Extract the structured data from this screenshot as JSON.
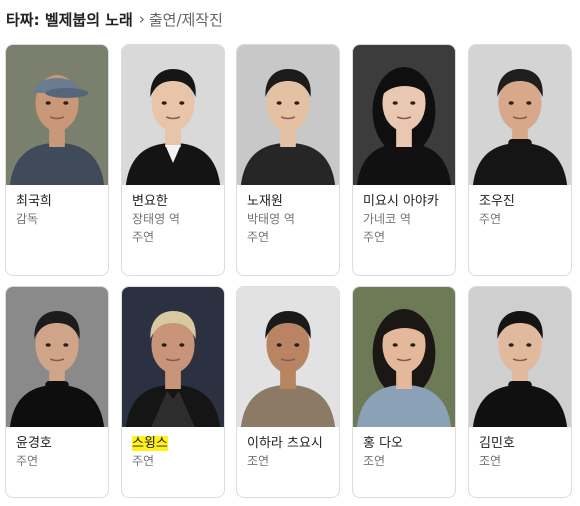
{
  "header": {
    "title": "타짜: 벨제붑의 노래",
    "chevron": "›",
    "subtitle": "출연/제작진"
  },
  "rows": [
    [
      {
        "name": "최국희",
        "roles": [
          "감독"
        ],
        "photo": {
          "bg": "#7a7f6e",
          "skin": "#c99878",
          "hair": "#2a2a2a",
          "shirt": "#3f4a5a",
          "accessory": "cap"
        }
      },
      {
        "name": "변요한",
        "roles": [
          "장태영 역",
          "주연"
        ],
        "photo": {
          "bg": "#d9d9d9",
          "skin": "#e8c4a8",
          "hair": "#161616",
          "shirt": "#141414",
          "accessory": "shirt-collar"
        }
      },
      {
        "name": "노재원",
        "roles": [
          "박태영 역",
          "주연"
        ],
        "photo": {
          "bg": "#c8c8c8",
          "skin": "#e3c1a2",
          "hair": "#1b1b1b",
          "shirt": "#262626",
          "accessory": "none"
        }
      },
      {
        "name": "미요시 아야카",
        "roles": [
          "가네코 역",
          "주연"
        ],
        "photo": {
          "bg": "#3c3c3c",
          "skin": "#e9c7b0",
          "hair": "#0f0f0f",
          "shirt": "#111111",
          "accessory": "long-hair"
        }
      },
      {
        "name": "조우진",
        "roles": [
          "주연"
        ],
        "photo": {
          "bg": "#d4d4d4",
          "skin": "#d7a98a",
          "hair": "#1e1e1e",
          "shirt": "#151515",
          "accessory": "turtleneck"
        }
      }
    ],
    [
      {
        "name": "윤경호",
        "roles": [
          "주연"
        ],
        "photo": {
          "bg": "#8a8a8a",
          "skin": "#cfa488",
          "hair": "#1c1c1c",
          "shirt": "#0e0e0e",
          "accessory": "turtleneck"
        }
      },
      {
        "name": "스윙스",
        "roles": [
          "주연"
        ],
        "highlight": true,
        "photo": {
          "bg": "#2b3140",
          "skin": "#c8957a",
          "hair": "#d9c9a3",
          "shirt": "#151515",
          "accessory": "jacket"
        }
      },
      {
        "name": "이하라 츠요시",
        "roles": [
          "조연"
        ],
        "photo": {
          "bg": "#e2e2e2",
          "skin": "#b98462",
          "hair": "#1a1a1a",
          "shirt": "#8c7a66",
          "accessory": "none"
        }
      },
      {
        "name": "홍 다오",
        "roles": [
          "조연"
        ],
        "photo": {
          "bg": "#6c7a55",
          "skin": "#e4b99b",
          "hair": "#1a1714",
          "shirt": "#8ba1b8",
          "accessory": "bob-hair"
        }
      },
      {
        "name": "김민호",
        "roles": [
          "조연"
        ],
        "photo": {
          "bg": "#cfcfcf",
          "skin": "#e1b99c",
          "hair": "#141414",
          "shirt": "#101010",
          "accessory": "turtleneck"
        }
      }
    ]
  ]
}
